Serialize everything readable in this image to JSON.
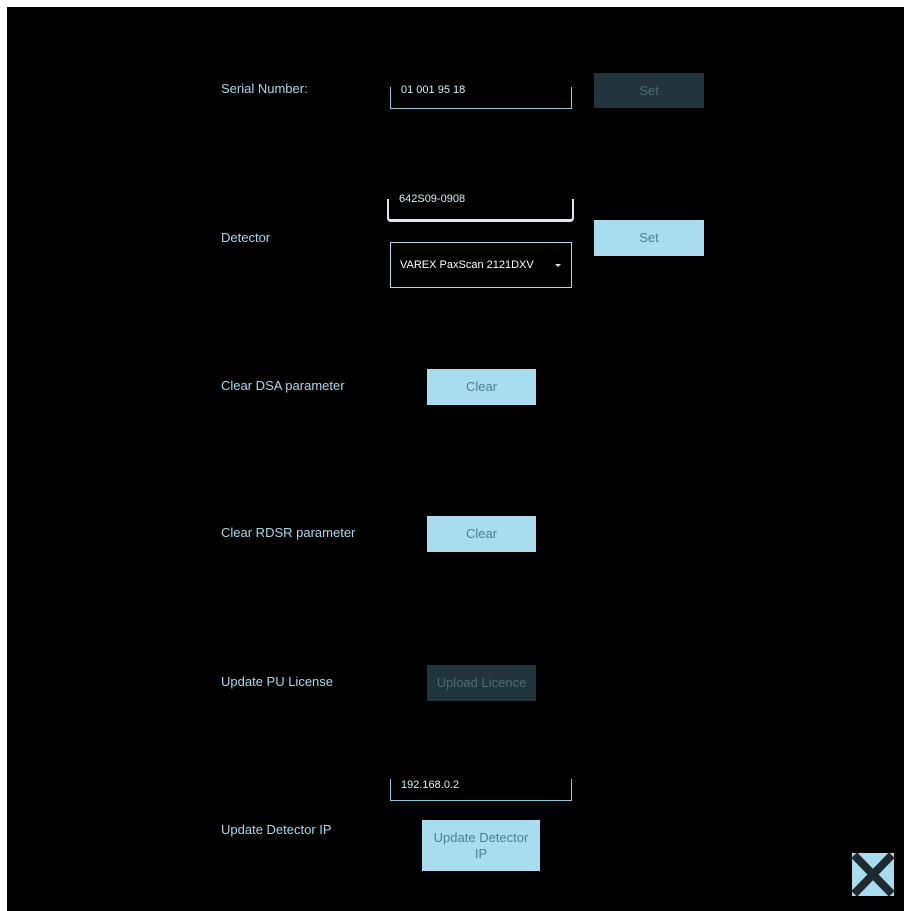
{
  "serial": {
    "label": "Serial Number:",
    "value": "01 001 95 18",
    "set_label": "Set"
  },
  "detector": {
    "label": "Detector",
    "value": "642S09-0908",
    "selected": "VAREX PaxScan 2121DXV",
    "set_label": "Set"
  },
  "dsa": {
    "label": "Clear DSA parameter",
    "button": "Clear"
  },
  "rdsr": {
    "label": "Clear RDSR parameter",
    "button": "Clear"
  },
  "license": {
    "label": "Update PU License",
    "button": "Upload Licence"
  },
  "detector_ip": {
    "label": "Update Detector IP",
    "value": "192.168.0.2",
    "button_line1": "Update Detector",
    "button_line2": "IP"
  },
  "icons": {
    "close": "close-icon",
    "dropdown": "chevron-down-icon"
  },
  "colors": {
    "background": "#000000",
    "accent": "#a9dcef",
    "label": "#aad8ea",
    "disabled": "#22353d"
  }
}
